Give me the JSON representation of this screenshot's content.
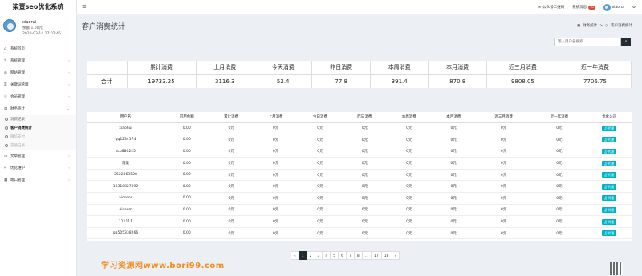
{
  "app": {
    "title": "柒壹seo优化系统"
  },
  "user": {
    "name": "xiaorui",
    "balance": "余额:1.00元",
    "date": "2020-03-14 17:02:46"
  },
  "menu": [
    {
      "label": "系统首页",
      "icon": "home-icon",
      "glyph": "⌂",
      "chevron": false
    },
    {
      "label": "系统管理",
      "icon": "wrench-icon",
      "glyph": "✎",
      "chevron": true
    },
    {
      "label": "网站管理",
      "icon": "globe-icon",
      "glyph": "◍",
      "chevron": true
    },
    {
      "label": "关键词管理",
      "icon": "key-icon",
      "glyph": "⚿",
      "chevron": true
    },
    {
      "label": "会员管理",
      "icon": "users-icon",
      "glyph": "⚇",
      "chevron": true
    },
    {
      "label": "财务统计",
      "icon": "chart-icon",
      "glyph": "▤",
      "chevron": false
    }
  ],
  "submenu": [
    {
      "label": "消费记录",
      "state": "normal"
    },
    {
      "label": "客户消费统计",
      "state": "active"
    },
    {
      "label": "微信支付",
      "state": "disabled"
    },
    {
      "label": "充值记录",
      "state": "disabled"
    }
  ],
  "menu_after": [
    {
      "label": "文章管理",
      "icon": "file-icon",
      "glyph": "▭",
      "chevron": true
    },
    {
      "label": "优化维护",
      "icon": "tools-icon",
      "glyph": "✂",
      "chevron": true
    },
    {
      "label": "端口管理",
      "icon": "port-icon",
      "glyph": "▦",
      "chevron": true
    }
  ],
  "topbar": {
    "qrcode": "公众号二维码",
    "messages": "系统消息",
    "message_count": "10",
    "username": "xiaorui"
  },
  "page": {
    "title": "客户消费统计"
  },
  "breadcrumb": {
    "home": "财务统计",
    "sep": ">",
    "current": "客户消费统计"
  },
  "search": {
    "placeholder": "输入用户名搜索"
  },
  "summary": {
    "headers": [
      "累计消费",
      "上月消费",
      "今天消费",
      "昨日消费",
      "本周消费",
      "本月消费",
      "近三月消费",
      "近一年消费"
    ],
    "row_label": "合计",
    "values": [
      "19733.25",
      "3116.3",
      "52.4",
      "77.8",
      "391.4",
      "870.8",
      "9808.05",
      "7706.75"
    ]
  },
  "detail": {
    "headers": [
      "用户名",
      "可用余额",
      "累计消费",
      "上月消费",
      "今日消费",
      "昨日消费",
      "本周消费",
      "本月消费",
      "近三月消费",
      "近一年消费",
      "优化公司"
    ],
    "action_label": "品代理",
    "rows": [
      [
        "xiaohui",
        "0.00",
        "0元",
        "0元",
        "0元",
        "0元",
        "0元",
        "0元",
        "0元",
        "0元"
      ],
      [
        "qq1234174",
        "0.00",
        "0元",
        "0元",
        "0元",
        "0元",
        "0元",
        "0元",
        "0元",
        "0元"
      ],
      [
        "scb880225",
        "0.00",
        "0元",
        "0元",
        "0元",
        "0元",
        "0元",
        "0元",
        "0元",
        "0元"
      ],
      [
        "落葉",
        "0.00",
        "0元",
        "0元",
        "0元",
        "0元",
        "0元",
        "0元",
        "0元",
        "0元"
      ],
      [
        "2522363528",
        "0.00",
        "0元",
        "0元",
        "0元",
        "0元",
        "0元",
        "0元",
        "0元",
        "0元"
      ],
      [
        "18318827392",
        "0.00",
        "0元",
        "0元",
        "0元",
        "0元",
        "0元",
        "0元",
        "0元",
        "0元"
      ],
      [
        "aioseos",
        "0.00",
        "0元",
        "0元",
        "0元",
        "0元",
        "0元",
        "0元",
        "0元",
        "0元"
      ],
      [
        "Aiosem",
        "0.00",
        "0元",
        "0元",
        "0元",
        "0元",
        "0元",
        "0元",
        "0元",
        "0元"
      ],
      [
        "111111",
        "0.00",
        "0元",
        "0元",
        "0元",
        "0元",
        "0元",
        "0元",
        "0元",
        "0元"
      ],
      [
        "qq505338266",
        "0.00",
        "0元",
        "0元",
        "0元",
        "0元",
        "0元",
        "0元",
        "0元",
        "0元"
      ]
    ]
  },
  "pagination": [
    "«",
    "1",
    "2",
    "3",
    "4",
    "5",
    "6",
    "7",
    "8",
    "...",
    "17",
    "18",
    "»"
  ],
  "pagination_active": "1",
  "watermark": "学习资源网www.bori99.com",
  "colors": {
    "accent": "#222d32",
    "action": "#00b3c8",
    "alert": "#e33333",
    "watermark": "#f28c1a"
  }
}
